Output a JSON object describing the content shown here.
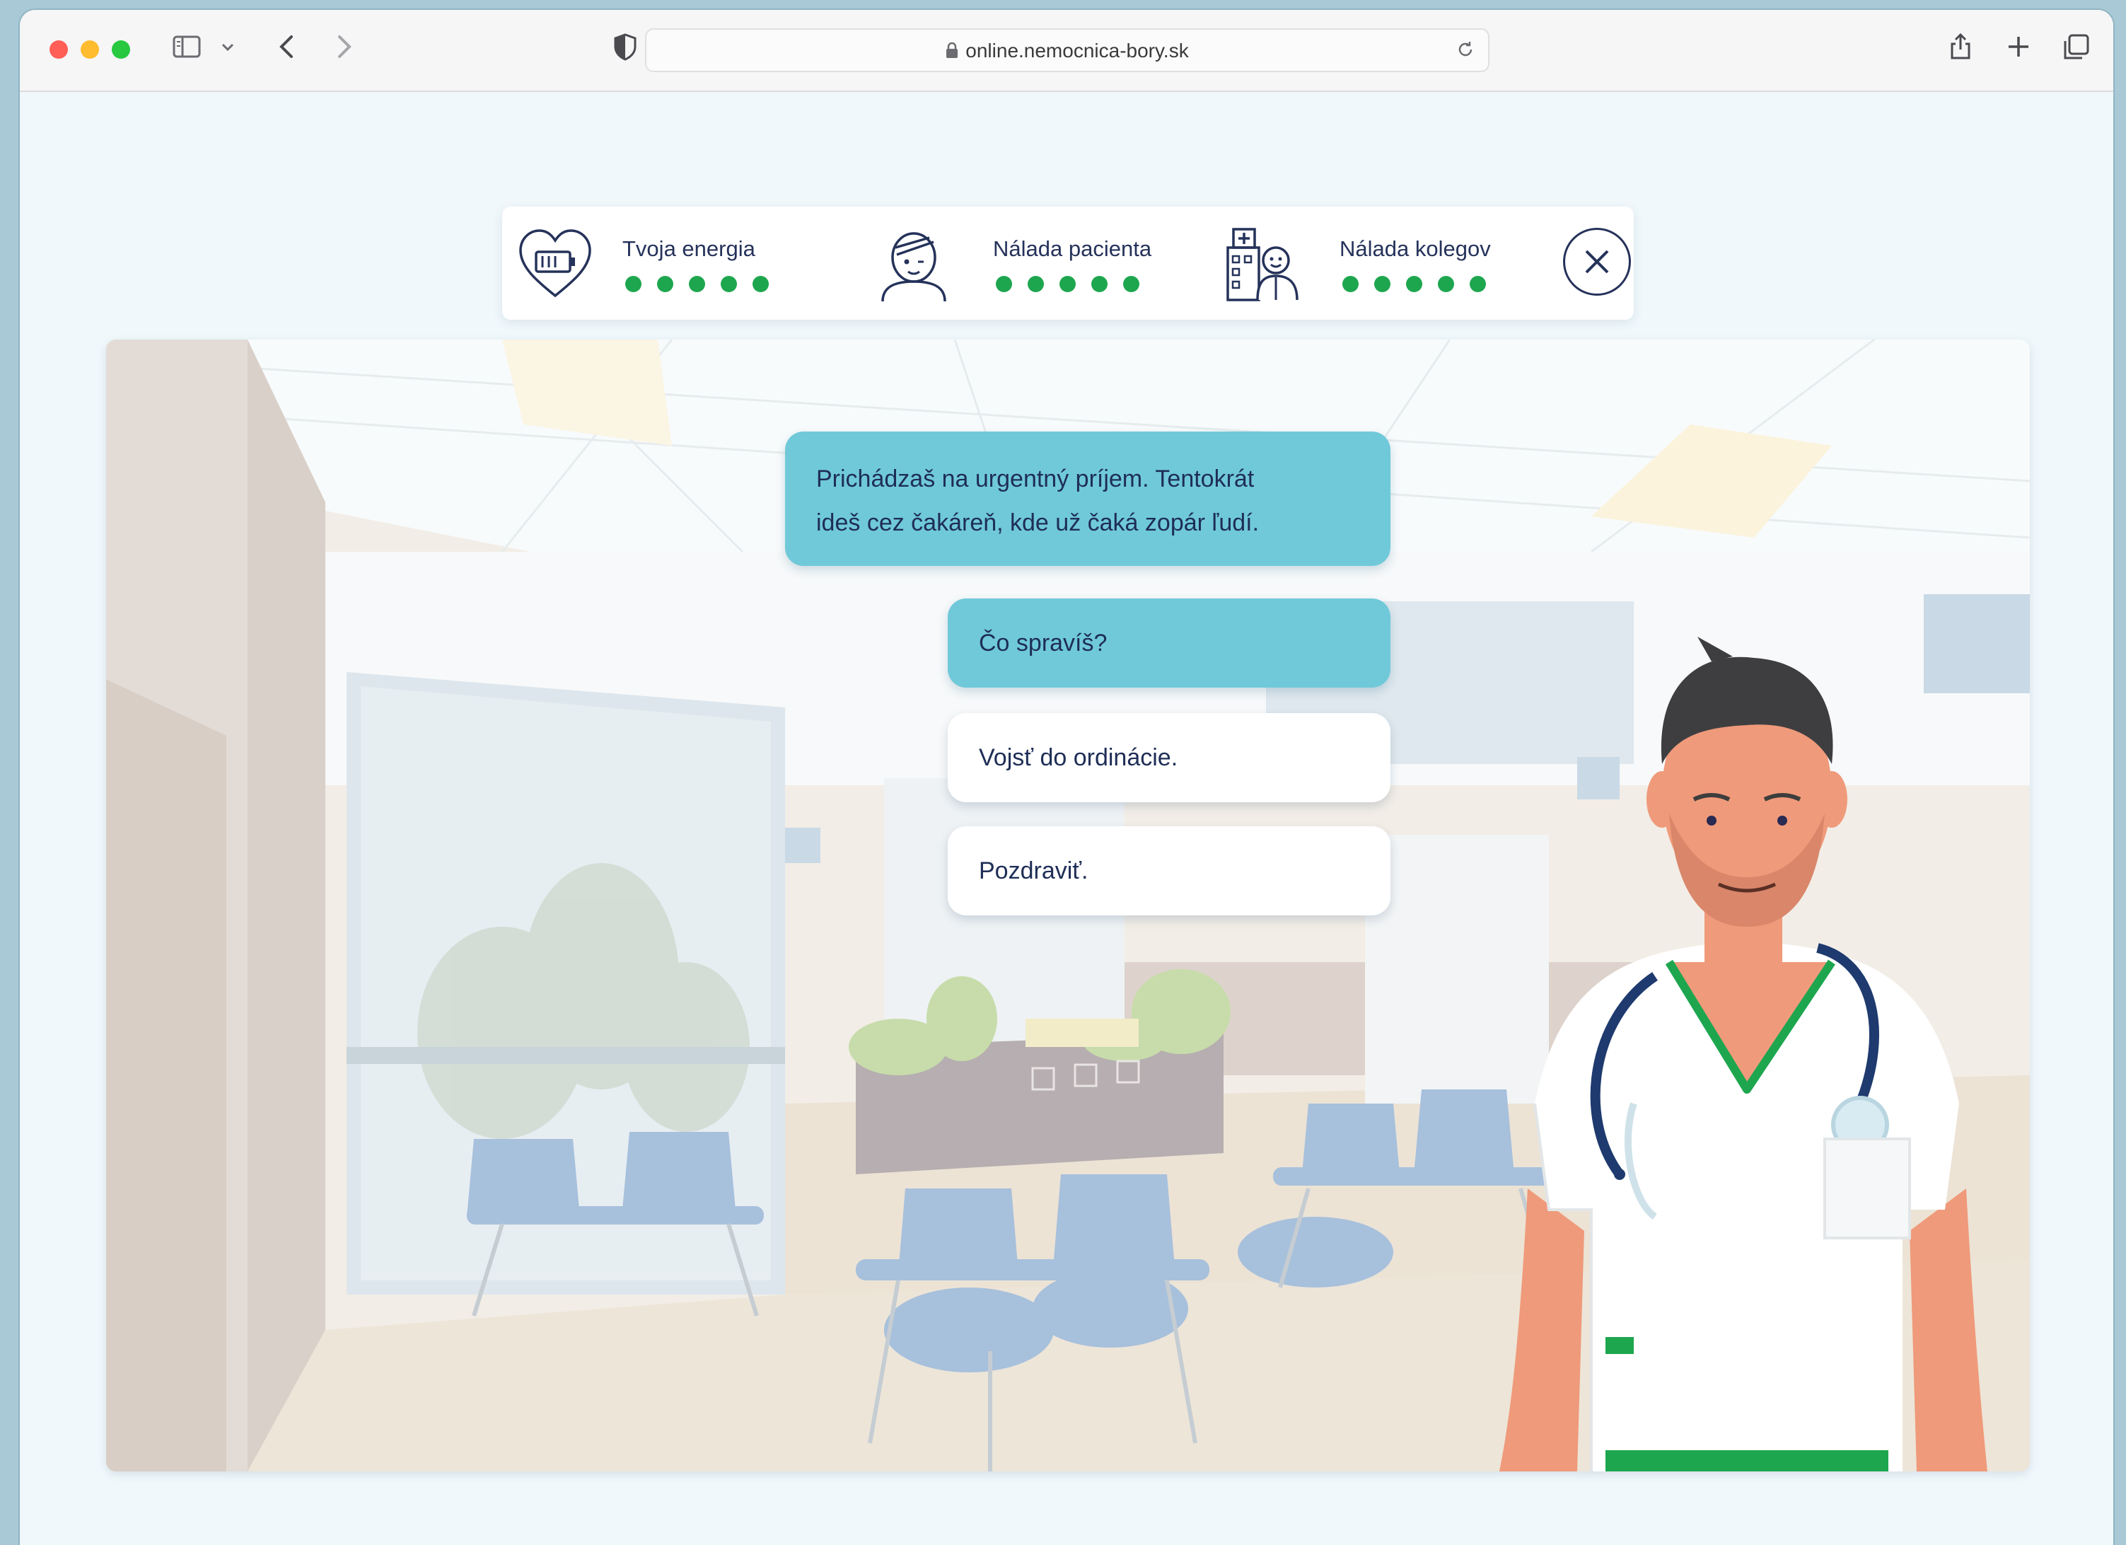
{
  "browser": {
    "url": "online.nemocnica-bory.sk"
  },
  "status": {
    "energy": {
      "label": "Tvoja energia",
      "level": 5,
      "max": 5,
      "icon": "heart-battery-icon"
    },
    "patient": {
      "label": "Nálada pacienta",
      "level": 5,
      "max": 5,
      "icon": "patient-icon"
    },
    "colleagues": {
      "label": "Nálada kolegov",
      "level": 5,
      "max": 5,
      "icon": "hospital-colleague-icon"
    },
    "dot_color": "#1ea64f"
  },
  "dialog": {
    "narration_line1": "Prichádzaš na urgentný príjem. Tentokrát",
    "narration_line2": "ideš cez čakáreň, kde už čaká zopár ľudí.",
    "question": "Čo spravíš?",
    "options": [
      {
        "label": "Vojsť do ordinácie."
      },
      {
        "label": "Pozdraviť."
      }
    ]
  },
  "colors": {
    "accent": "#70c9d9",
    "text": "#1e2e56",
    "scrubs_trim": "#1ea64f"
  }
}
